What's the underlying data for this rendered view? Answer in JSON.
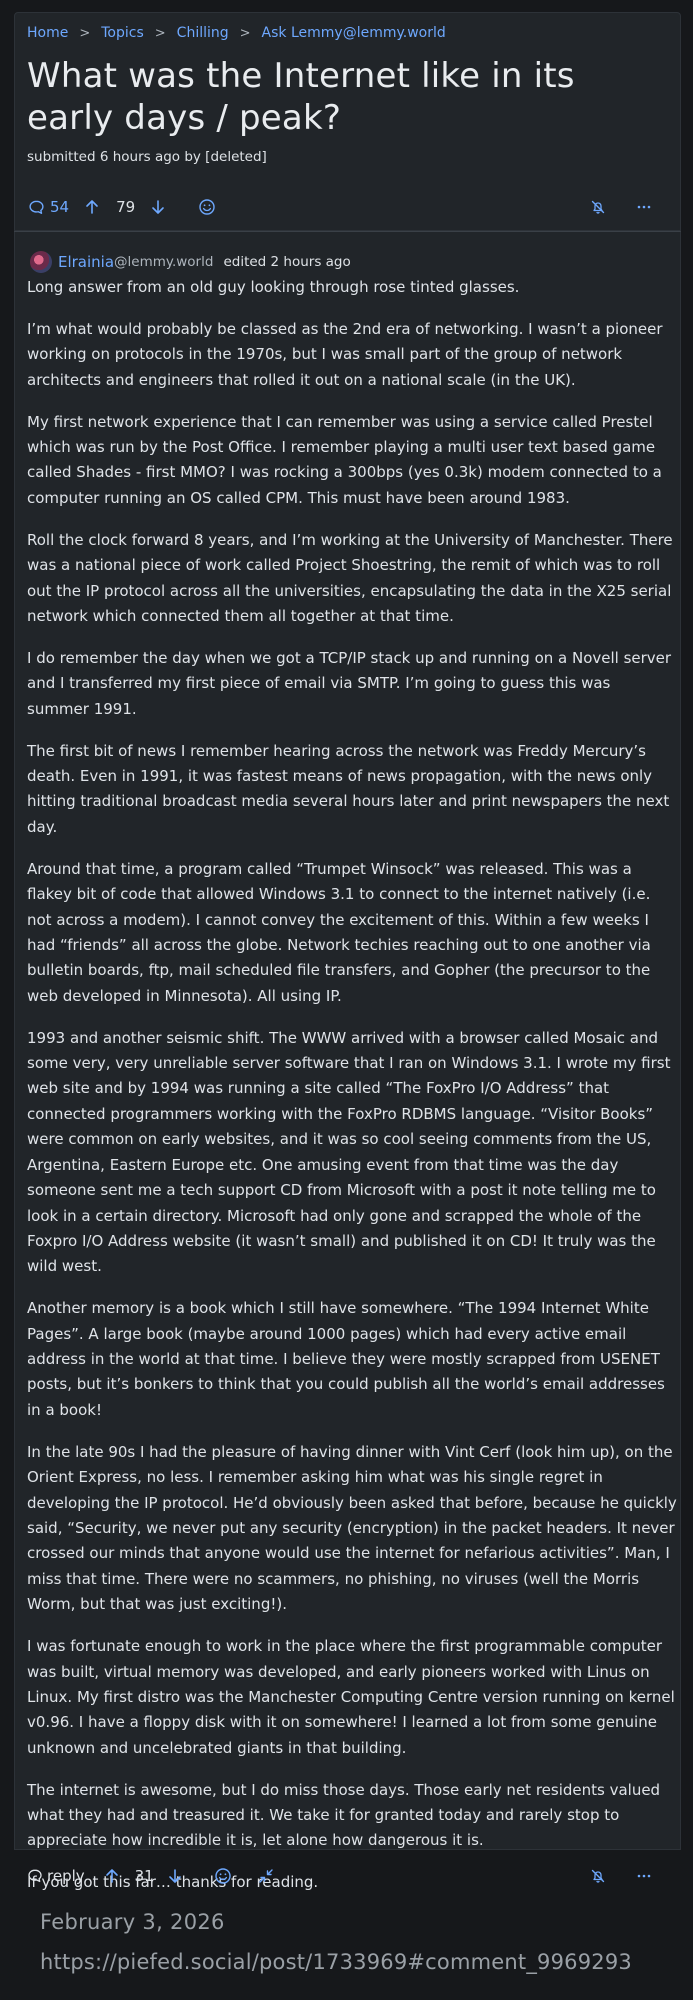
{
  "breadcrumb": [
    "Home",
    "Topics",
    "Chilling",
    "Ask Lemmy@lemmy.world"
  ],
  "post": {
    "title": "What was the Internet like in its early days / peak?",
    "submitted": "submitted 6 hours ago by [deleted]",
    "comment_count": "54",
    "score": "79"
  },
  "comment": {
    "author": "Elrainia",
    "instance": "@lemmy.world",
    "edited": "edited 2 hours ago",
    "paragraphs": [
      "Long answer from an old guy looking through rose tinted glasses.",
      "I’m what would probably be classed as the 2nd era of networking. I wasn’t a pioneer working on protocols in the 1970s, but I was small part of the group of network architects and engineers that rolled it out on a national scale (in the UK).",
      "My first network experience that I can remember was using a service called Prestel which was run by the Post Office. I remember playing a multi user text based game called Shades - first MMO? I was rocking a 300bps (yes 0.3k) modem connected to a computer running an OS called CPM. This must have been around 1983.",
      "Roll the clock forward 8 years, and I’m working at the University of Manchester. There was a national piece of work called Project Shoestring, the remit of which was to roll out the IP protocol across all the universities, encapsulating the data in the X25 serial network which connected them all together at that time.",
      "I do remember the day when we got a TCP/IP stack up and running on a Novell server and I transferred my first piece of email via SMTP. I’m going to guess this was summer 1991.",
      "The first bit of news I remember hearing across the network was Freddy Mercury’s death. Even in 1991, it was fastest means of news propagation, with the news only hitting traditional broadcast media several hours later and print newspapers the next day.",
      "Around that time, a program called “Trumpet Winsock” was released. This was a flakey bit of code that allowed Windows 3.1 to connect to the internet natively (i.e. not across a modem). I cannot convey the excitement of this. Within a few weeks I had “friends” all across the globe. Network techies reaching out to one another via bulletin boards, ftp, mail scheduled file transfers, and Gopher (the precursor to the web developed in Minnesota). All using IP.",
      "1993 and another seismic shift. The WWW arrived with a browser called Mosaic and some very, very unreliable server software that I ran on Windows 3.1. I wrote my first web site and by 1994 was running a site called “The FoxPro I/O Address” that connected programmers working with the FoxPro RDBMS language. “Visitor Books” were common on early websites, and it was so cool seeing comments from the US, Argentina, Eastern Europe etc. One amusing event from that time was the day someone sent me a tech support CD from Microsoft with a post it note telling me to look in a certain directory. Microsoft had only gone and scrapped the whole of the Foxpro I/O Address website (it wasn’t small) and published it on CD! It truly was the wild west.",
      "Another memory is a book which I still have somewhere. “The 1994 Internet White Pages”. A large book (maybe around 1000 pages) which had every active email address in the world at that time. I believe they were mostly scrapped from USENET posts, but it’s bonkers to think that you could publish all the world’s email addresses in a book!",
      "In the late 90s I had the pleasure of having dinner with Vint Cerf (look him up), on the Orient Express, no less. I remember asking him what was his single regret in developing the IP protocol. He’d obviously been asked that before, because he quickly said, “Security, we never put any security (encryption) in the packet headers. It never crossed our minds that anyone would use the internet for nefarious activities”. Man, I miss that time. There were no scammers, no phishing, no viruses (well the Morris Worm, but that was just exciting!).",
      "I was fortunate enough to work in the place where the first programmable computer was built, virtual memory was developed, and early pioneers worked with Linus on Linux. My first distro was the Manchester Computing Centre version running on kernel v0.96. I have a floppy disk with it on somewhere! I learned a lot from some genuine unknown and uncelebrated giants in that building.",
      "The internet is awesome, but I do miss those days. Those early net residents valued what they had and treasured it. We take it for granted today and rarely stop to appreciate how incredible it is, let alone how dangerous it is.",
      "If you got this far… thanks for reading."
    ],
    "reply_label": "reply",
    "score": "31"
  },
  "footer": {
    "date": "February 3, 2026",
    "url": "https://piefed.social/post/1733969#comment_9969293"
  },
  "icons": {
    "comments": "speech-bubble-icon",
    "upvote": "arrow-up-icon",
    "downvote": "arrow-down-icon",
    "emoji": "smiley-icon",
    "notifications": "bell-slash-icon",
    "more": "ellipsis-icon",
    "collapse": "collapse-arrows-icon"
  },
  "colors": {
    "background": "#16181b",
    "card": "#212529",
    "accent": "#6ea8fe",
    "text": "#dfe3e8"
  }
}
